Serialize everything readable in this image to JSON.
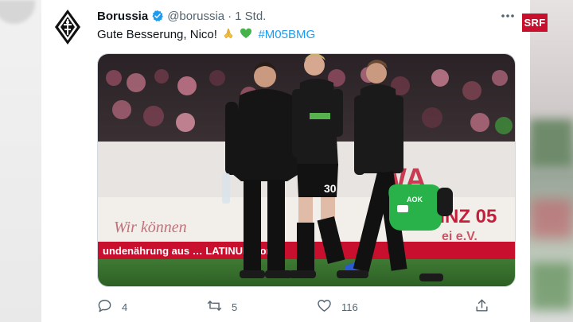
{
  "tweet": {
    "display_name": "Borussia",
    "handle": "@borussia",
    "separator": "·",
    "time": "1 Std.",
    "text": "Gute Besserung, Nico!",
    "hashtag": "#M05BMG",
    "media": {
      "banner_top": "WA",
      "banner_bottom": "undenährung aus   …   LATINUM.com",
      "ad_right": "AINZ 05",
      "ad_right2": "ei e.V.",
      "ad_left": "Wir können",
      "shirt_number": "30",
      "bag_text": "AOK"
    },
    "actions": {
      "reply_count": "4",
      "retweet_count": "5",
      "like_count": "116"
    }
  },
  "badge": {
    "label": "SRF"
  },
  "colors": {
    "link": "#1d9bf0",
    "muted": "#536471",
    "verified": "#1d9bf0",
    "srf": "#c8102e"
  },
  "icons": {
    "verified": "verified-badge-icon",
    "more": "more-horizontal-icon",
    "reply": "reply-icon",
    "retweet": "retweet-icon",
    "like": "heart-icon",
    "share": "share-icon"
  }
}
